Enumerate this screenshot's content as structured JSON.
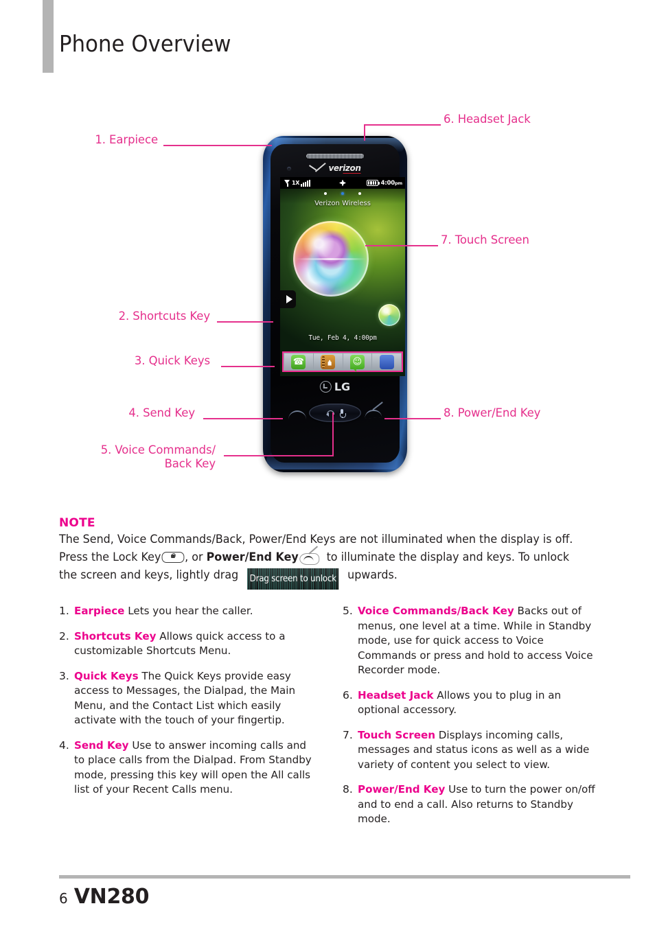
{
  "page": {
    "title": "Phone Overview",
    "footer_page_number": "6",
    "footer_model": "VN280",
    "accent_magenta": "#EC008C",
    "callout_pink": "#E5308C",
    "rule_gray": "#B4B4B4"
  },
  "diagram": {
    "callouts": [
      {
        "id": "earpiece",
        "label": "1. Earpiece"
      },
      {
        "id": "shortcuts-key",
        "label": "2. Shortcuts Key"
      },
      {
        "id": "quick-keys",
        "label": "3. Quick Keys"
      },
      {
        "id": "send-key",
        "label": "4. Send Key"
      },
      {
        "id": "voice-back-key",
        "label_line1": "5. Voice Commands/",
        "label_line2": "Back Key"
      },
      {
        "id": "headset-jack",
        "label": "6. Headset Jack"
      },
      {
        "id": "touch-screen",
        "label": "7. Touch Screen"
      },
      {
        "id": "power-end-key",
        "label": "8. Power/End Key"
      }
    ],
    "phone": {
      "brand_logo": "verizon",
      "oem_logo": "LG",
      "status_bar": {
        "network": "1X",
        "signal_bars": 5,
        "gps_icon": "gps-icon",
        "battery_icon": "battery-icon",
        "battery_level": 4,
        "time": "4:00",
        "time_meridiem": "pm"
      },
      "home_screen": {
        "page_dots_total": 3,
        "page_dots_active": 2,
        "carrier": "Verizon Wireless",
        "date_time": "Tue, Feb 4, 4:00pm",
        "shortcuts_tab_icon": "triangle-right-icon",
        "quick_keys": [
          {
            "name": "phone",
            "icon": "phone-icon"
          },
          {
            "name": "contacts",
            "icon": "contacts-book-icon"
          },
          {
            "name": "messages",
            "icon": "message-bubble-icon"
          },
          {
            "name": "menu",
            "icon": "grid-menu-icon"
          }
        ]
      },
      "hardware_keys": [
        {
          "name": "send-key",
          "icon": "handset-icon"
        },
        {
          "name": "voice-commands-back-key",
          "icon": "back-arrow-mic-icon"
        },
        {
          "name": "power-end-key",
          "icon": "handset-end-icon"
        }
      ]
    }
  },
  "note": {
    "title": "NOTE",
    "line1": "The Send, Voice Commands/Back, Power/End Keys are not illuminated when the display is off.",
    "line2_a": "Press the Lock Key",
    "line2_b": ", or ",
    "line2_bold": "Power/End Key",
    "line2_c": " to illuminate the display and keys. To unlock",
    "line3_a": "the screen and keys, lightly drag",
    "unlock_badge": "Drag screen to unlock",
    "line3_b": "upwards.",
    "lock_icon": "lock-key-icon",
    "end_icon": "power-end-key-icon"
  },
  "list": {
    "left": [
      {
        "num": "1.",
        "term": "Earpiece",
        "desc": " Lets you hear the caller."
      },
      {
        "num": "2.",
        "term": "Shortcuts Key",
        "desc": " Allows quick access to a customizable Shortcuts Menu."
      },
      {
        "num": "3.",
        "term": "Quick Keys",
        "desc": " The Quick Keys provide easy access to Messages, the Dialpad, the Main Menu, and the Contact List which easily activate with the touch of your fingertip."
      },
      {
        "num": "4.",
        "term": "Send Key",
        "desc": " Use to answer incoming calls and to place calls from the Dialpad. From Standby mode, pressing this key will open the All calls list of your Recent Calls menu."
      }
    ],
    "right": [
      {
        "num": "5.",
        "term": "Voice Commands/Back Key",
        "desc": " Backs out of menus, one level at a time. While in Standby mode, use for quick access to Voice Commands or press and hold to access Voice Recorder mode."
      },
      {
        "num": "6.",
        "term": "Headset Jack",
        "desc": " Allows you to plug in an optional accessory."
      },
      {
        "num": "7.",
        "term": "Touch Screen",
        "desc": " Displays incoming calls, messages and status icons as well as a wide variety of content you select to view."
      },
      {
        "num": "8.",
        "term": "Power/End Key",
        "desc": " Use to turn the power on/off and to end a call. Also returns to Standby mode."
      }
    ]
  }
}
